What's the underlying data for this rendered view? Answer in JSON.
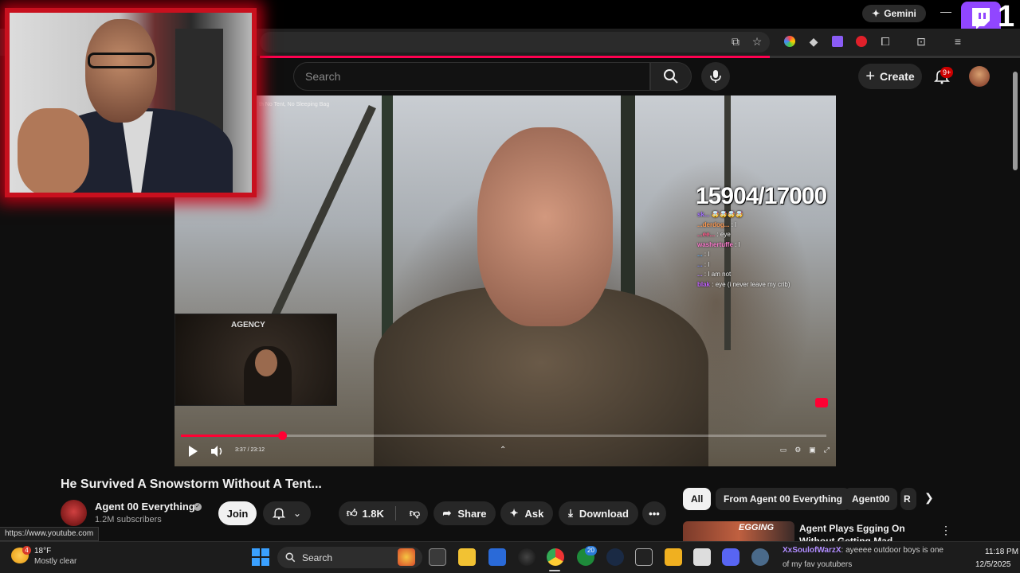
{
  "browser": {
    "gemini_label": "Gemini",
    "minimize_label": "—",
    "twitch_number": "1"
  },
  "youtube": {
    "search_placeholder": "Search",
    "create_label": "Create",
    "notification_count": "9+"
  },
  "player": {
    "top_caption": "th No Tent, No Sleeping Bag",
    "sub_counter": "15904/17000",
    "time": "3:37 / 23:12",
    "progress": 0.157,
    "chat": [
      {
        "user": "sk...",
        "text": "🤯🤯🤯🤯"
      },
      {
        "user": "...derdog...",
        "text": ": l"
      },
      {
        "user": "...ee...",
        "text": ": eye"
      },
      {
        "user": "washertuffe",
        "text": ": l"
      },
      {
        "user": "...",
        "text": ": l"
      },
      {
        "user": "...",
        "text": ": l"
      },
      {
        "user": "...",
        "text": ": I am not"
      },
      {
        "user": "blak",
        "text": ": eye (i never leave my crib)"
      }
    ],
    "cam_sign": "AGENCY",
    "colors": {
      "progress": "#ff0033",
      "webcam_border": "#c8101e"
    }
  },
  "video": {
    "title": "He Survived A Snowstorm Without A Tent...",
    "channel": "Agent 00 Everything",
    "subscribers": "1.2M subscribers",
    "join_label": "Join",
    "likes": "1.8K",
    "share_label": "Share",
    "ask_label": "Ask",
    "download_label": "Download"
  },
  "chips": {
    "all": "All",
    "from": "From Agent 00 Everything",
    "agent": "Agent00",
    "r": "R"
  },
  "recommendation": {
    "thumb_text": "EGGING",
    "title": "Agent Plays Egging On Without Getting Mad"
  },
  "status_url": "https://www.youtube.com",
  "taskbar": {
    "weather_badge": "4",
    "temperature": "18°F",
    "weather": "Mostly clear",
    "search_label": "Search",
    "xbox_badge": "20",
    "chat_user": "XxSoulofWarzX",
    "chat_text": ": ayeeee outdoor boys is one",
    "chat_text2": "of my fav youtubers",
    "time": "11:18 PM",
    "date": "12/5/2025"
  }
}
